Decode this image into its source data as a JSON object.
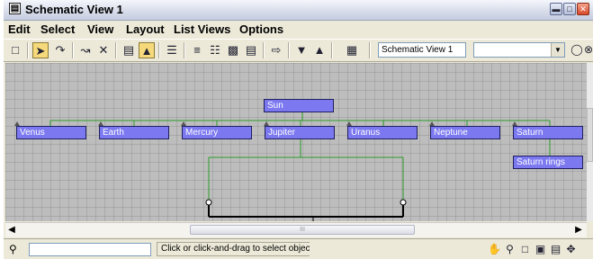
{
  "window": {
    "title": "Schematic View 1",
    "controls": [
      "minimize",
      "maximize",
      "close"
    ]
  },
  "menu": [
    "Edit",
    "Select",
    "View",
    "Layout",
    "List Views",
    "Options"
  ],
  "toolbar": {
    "icons": [
      "display-floater-icon",
      "select-icon",
      "connect-icon",
      "unlink-icon",
      "delete-icon",
      "hierarchy-mode-icon",
      "references-mode-icon",
      "always-arrange-icon",
      "arrange-children-icon",
      "arrange-selected-icon",
      "free-all-icon",
      "free-selected-icon",
      "move-children-icon",
      "expand-icon",
      "collapse-icon",
      "preferences-icon"
    ],
    "name_field": "Schematic View 1",
    "combo_value": ""
  },
  "nodes": [
    {
      "label": "Sun"
    },
    {
      "label": "Venus"
    },
    {
      "label": "Earth"
    },
    {
      "label": "Mercury"
    },
    {
      "label": "Jupiter"
    },
    {
      "label": "Uranus"
    },
    {
      "label": "Neptune"
    },
    {
      "label": "Saturn"
    },
    {
      "label": "Saturn rings"
    }
  ],
  "colors": {
    "node_fill": "#7b78f0",
    "node_border": "#1f1f5e",
    "link": "#2a9a2a",
    "canvas": "#bdbdbd"
  },
  "scrollbar": {
    "thumb_label": "III"
  },
  "status": {
    "search_value": "",
    "message": "Click or click-and-drag to select objects"
  }
}
